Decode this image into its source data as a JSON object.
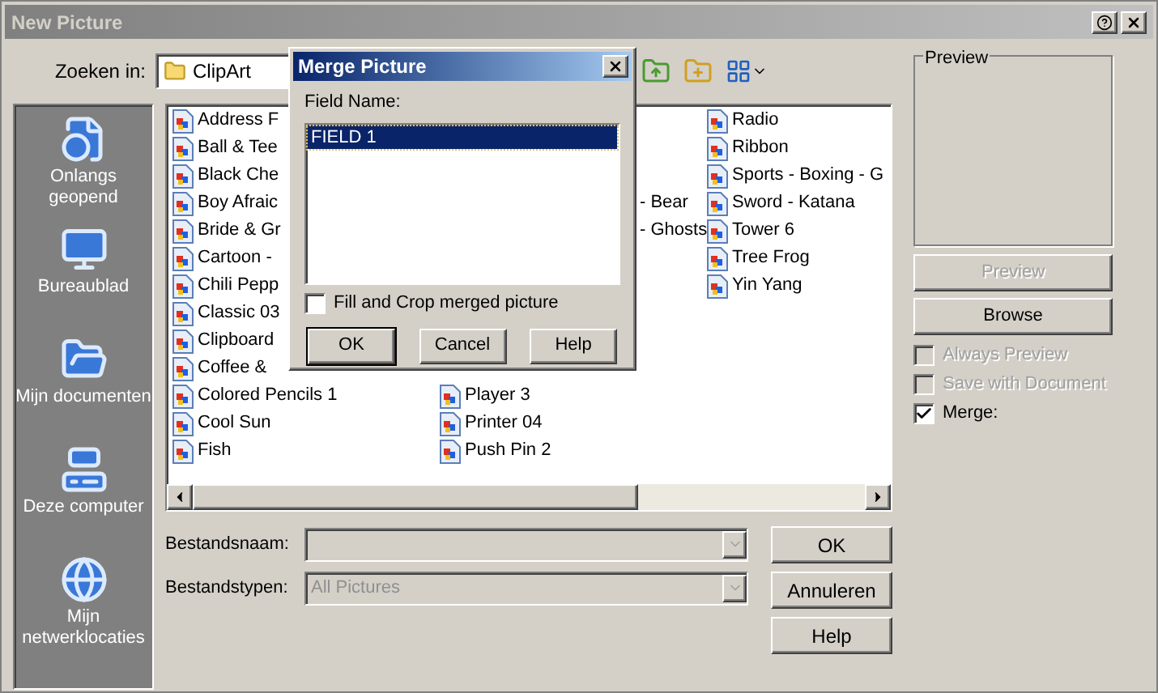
{
  "window": {
    "title": "New Picture"
  },
  "toolbar": {
    "look_in_label": "Zoeken in:",
    "look_in_value": "ClipArt"
  },
  "places": [
    {
      "label": "Onlangs geopend",
      "kind": "recent"
    },
    {
      "label": "Bureaublad",
      "kind": "desktop"
    },
    {
      "label": "Mijn documenten",
      "kind": "documents"
    },
    {
      "label": "Deze computer",
      "kind": "computer"
    },
    {
      "label": "Mijn netwerklocaties",
      "kind": "network"
    }
  ],
  "file_list": {
    "columns": [
      [
        {
          "label": "Address F",
          "kind": "file"
        },
        {
          "label": "Ball & Tee",
          "kind": "file"
        },
        {
          "label": "Black Che",
          "kind": "file"
        },
        {
          "label": "Boy Afraic",
          "kind": "file"
        },
        {
          "label": "Bride & Gr",
          "kind": "file"
        },
        {
          "label": "Cartoon -",
          "kind": "file"
        },
        {
          "label": "Chili Pepp",
          "kind": "file"
        },
        {
          "label": "Classic 03",
          "kind": "file"
        },
        {
          "label": "Clipboard",
          "kind": "file"
        },
        {
          "label": "Coffee &",
          "kind": "file"
        },
        {
          "label": "Colored Pencils 1",
          "kind": "file"
        },
        {
          "label": "Cool Sun",
          "kind": "file"
        },
        {
          "label": "Fish",
          "kind": "file"
        }
      ],
      [
        {
          "label": "- Bear",
          "kind": "cut"
        },
        {
          "label": "- Ghosts",
          "kind": "cut"
        },
        {
          "label": "Player 3",
          "kind": "file"
        },
        {
          "label": "Printer 04",
          "kind": "file"
        },
        {
          "label": "Push Pin 2",
          "kind": "file"
        }
      ],
      [
        {
          "label": "Radio",
          "kind": "file"
        },
        {
          "label": "Ribbon",
          "kind": "file"
        },
        {
          "label": "Sports - Boxing - G",
          "kind": "file"
        },
        {
          "label": "Sword - Katana",
          "kind": "file"
        },
        {
          "label": "Tower 6",
          "kind": "file"
        },
        {
          "label": "Tree Frog",
          "kind": "file"
        },
        {
          "label": "Yin Yang",
          "kind": "file"
        }
      ]
    ]
  },
  "file_name": {
    "label": "Bestandsnaam:",
    "disabled": true
  },
  "file_type": {
    "label": "Bestandstypen:",
    "value": "All Pictures",
    "disabled": true
  },
  "dialog_buttons": [
    {
      "label": "OK",
      "disabled": false
    },
    {
      "label": "Annuleren",
      "disabled": false
    },
    {
      "label": "Help",
      "disabled": false
    }
  ],
  "preview": {
    "group_label": "Preview"
  },
  "side_buttons": [
    {
      "label": "Preview",
      "disabled": true
    },
    {
      "label": "Browse",
      "disabled": false
    }
  ],
  "options": [
    {
      "label": "Always Preview",
      "checked": false,
      "disabled": true
    },
    {
      "label": "Save with Document",
      "checked": false,
      "disabled": true
    },
    {
      "label": "Merge:",
      "checked": true,
      "disabled": false
    }
  ],
  "merge_dialog": {
    "title": "Merge Picture",
    "field_label": "Field Name:",
    "fields": [
      {
        "label": "FIELD 1",
        "selected": true
      }
    ],
    "fill_crop": {
      "label": "Fill and Crop merged picture",
      "checked": false
    },
    "buttons": [
      {
        "label": "OK",
        "default": true
      },
      {
        "label": "Cancel",
        "default": false
      },
      {
        "label": "Help",
        "default": false
      }
    ]
  }
}
